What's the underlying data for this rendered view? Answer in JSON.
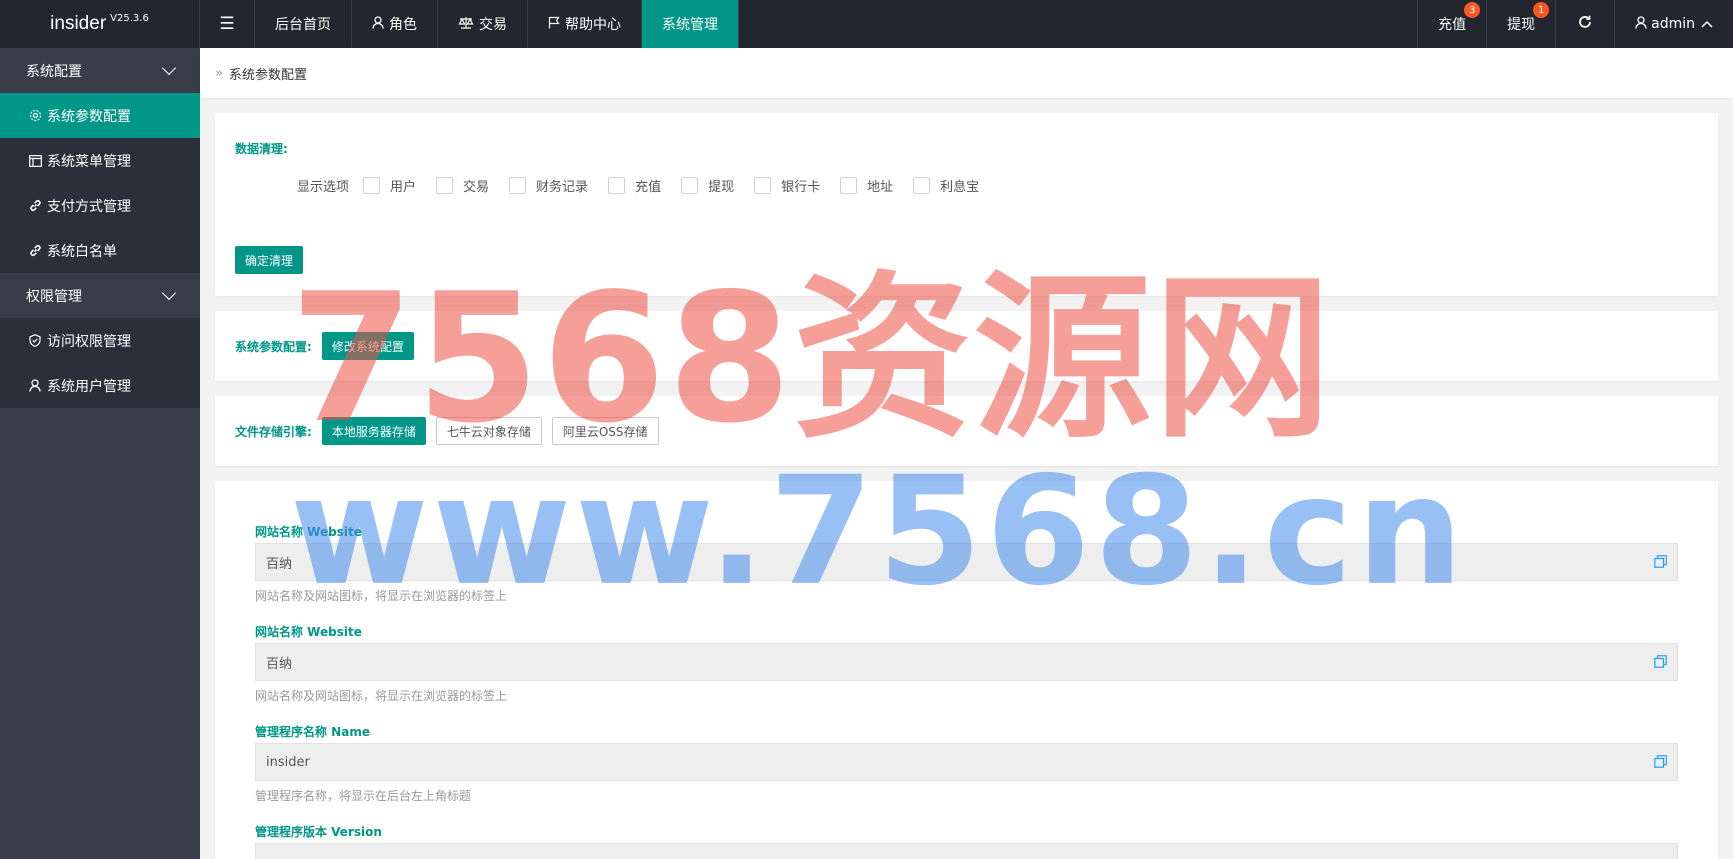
{
  "app": {
    "name": "insider",
    "version": "V25.3.6"
  },
  "topnav": {
    "toggle_icon": "menu-toggle-icon",
    "items": [
      {
        "label": "后台首页",
        "icon": ""
      },
      {
        "label": "角色",
        "icon": "user-icon"
      },
      {
        "label": "交易",
        "icon": "scale-icon"
      },
      {
        "label": "帮助中心",
        "icon": "flag-icon"
      },
      {
        "label": "系统管理",
        "icon": "",
        "active": true
      }
    ]
  },
  "rightnav": {
    "recharge": {
      "label": "充值",
      "badge": "3"
    },
    "withdraw": {
      "label": "提现",
      "badge": "1"
    },
    "refresh_icon": "refresh-icon",
    "user": {
      "label": "admin"
    }
  },
  "sidebar": {
    "groups": [
      {
        "label": "系统配置",
        "items": [
          {
            "label": "系统参数配置",
            "icon": "gear-icon",
            "active": true
          },
          {
            "label": "系统菜单管理",
            "icon": "window-icon"
          },
          {
            "label": "支付方式管理",
            "icon": "link-icon"
          },
          {
            "label": "系统白名单",
            "icon": "link-icon"
          }
        ]
      },
      {
        "label": "权限管理",
        "items": [
          {
            "label": "访问权限管理",
            "icon": "shield-icon"
          },
          {
            "label": "系统用户管理",
            "icon": "user-icon"
          }
        ]
      }
    ]
  },
  "breadcrumb": {
    "current": "系统参数配置"
  },
  "data_clear": {
    "title": "数据清理:",
    "options_label": "显示选项",
    "options": [
      "用户",
      "交易",
      "财务记录",
      "充值",
      "提现",
      "银行卡",
      "地址",
      "利息宝"
    ],
    "confirm_button": "确定清理"
  },
  "sys_config": {
    "label": "系统参数配置:",
    "button": "修改系统配置"
  },
  "storage": {
    "label": "文件存储引擎:",
    "buttons": [
      "本地服务器存储",
      "七牛云对象存储",
      "阿里云OSS存储"
    ],
    "active_index": 0
  },
  "form": {
    "fields": [
      {
        "label": "网站名称 Website",
        "value": "百纳",
        "help": "网站名称及网站图标，将显示在浏览器的标签上"
      },
      {
        "label": "网站名称 Website",
        "value": "百纳",
        "help": "网站名称及网站图标，将显示在浏览器的标签上"
      },
      {
        "label": "管理程序名称 Name",
        "value": "insider",
        "help": "管理程序名称，将显示在后台左上角标题"
      },
      {
        "label": "管理程序版本 Version",
        "value": "",
        "help": ""
      }
    ]
  },
  "watermark": {
    "line1": "7568资源网",
    "line2": "www.7568.cn"
  },
  "colors": {
    "accent": "#009688",
    "header_bg": "#23262e",
    "sidebar_bg": "#393d49",
    "badge": "#ff5722"
  }
}
